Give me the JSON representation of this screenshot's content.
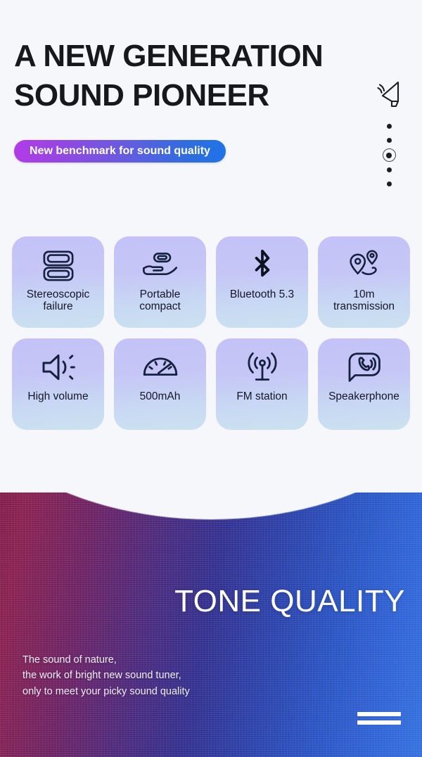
{
  "hero": {
    "headline_line1": "A NEW GENERATION",
    "headline_line2": "SOUND PIONEER",
    "badge_label": "New benchmark for sound quality",
    "speaker_icon": "speaker-outline-icon",
    "dots_count": 5,
    "active_dot_index": 3
  },
  "features": [
    {
      "icon": "stacked-speakers-icon",
      "label": "Stereoscopic\nfailure"
    },
    {
      "icon": "hand-holding-device-icon",
      "label": "Portable\ncompact"
    },
    {
      "icon": "bluetooth-icon",
      "label": "Bluetooth 5.3"
    },
    {
      "icon": "map-pins-icon",
      "label": "10m\ntransmission"
    },
    {
      "icon": "volume-high-icon",
      "label": "High volume"
    },
    {
      "icon": "gauge-icon",
      "label": "500mAh"
    },
    {
      "icon": "radio-broadcast-icon",
      "label": "FM station"
    },
    {
      "icon": "speech-bubble-phone-icon",
      "label": "Speakerphone"
    }
  ],
  "tone": {
    "title": "TONE QUALITY",
    "copy": "The sound of nature,\nthe work of bright new sound tuner,\nonly to meet your picky sound quality",
    "equals_icon": "equals-bars-icon"
  },
  "colors": {
    "page_background": "#f6f7fb",
    "heading_text": "#17181c",
    "badge_gradient_start": "#b13ce6",
    "badge_gradient_end": "#1f73e8",
    "card_gradient_start": "#c4c2f8",
    "card_gradient_end": "#cbe2f1",
    "card_icon": "#15213f",
    "bottom_gradient_start": "#7d1a47",
    "bottom_gradient_mid": "#33308f",
    "bottom_gradient_end": "#3570de",
    "bottom_text": "#ffffff"
  }
}
